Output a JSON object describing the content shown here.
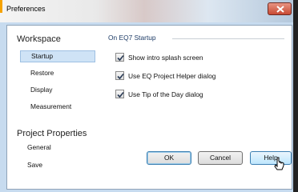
{
  "window": {
    "title": "Preferences"
  },
  "sidebar": {
    "sections": [
      {
        "title": "Workspace",
        "items": [
          "Startup",
          "Restore",
          "Display",
          "Measurement"
        ]
      },
      {
        "title": "Project Properties",
        "items": [
          "General",
          "Save"
        ]
      }
    ],
    "selected_item": "Startup"
  },
  "content": {
    "group_title": "On EQ7 Startup",
    "options": [
      {
        "label": "Show intro splash screen",
        "checked": true
      },
      {
        "label": "Use EQ Project Helper dialog",
        "checked": true
      },
      {
        "label": "Use Tip of the Day dialog",
        "checked": true
      }
    ]
  },
  "buttons": {
    "ok": "OK",
    "cancel": "Cancel",
    "help": "Help"
  },
  "icons": {
    "close": "close-icon",
    "check": "checkmark-icon",
    "cursor": "mouse-pointer-icon"
  }
}
